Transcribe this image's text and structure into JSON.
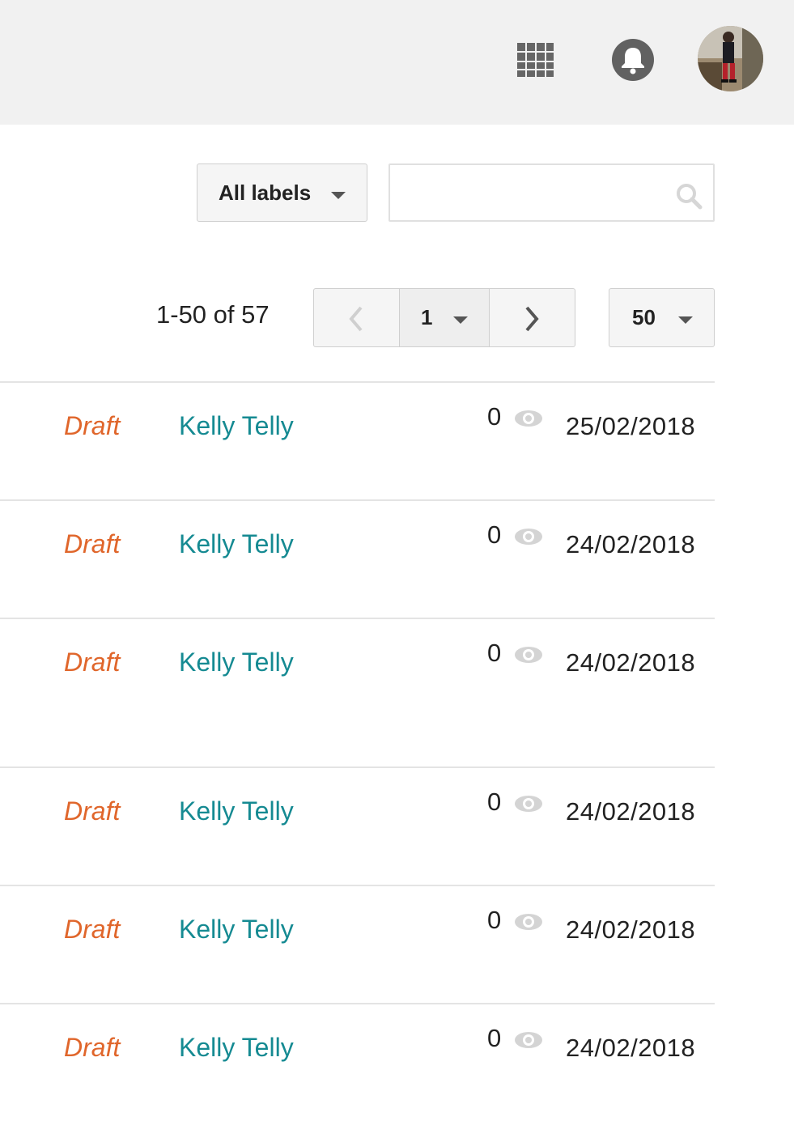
{
  "topbar": {
    "apps_icon": "apps-grid-icon",
    "notifications_icon": "bell-icon",
    "avatar_icon": "user-avatar"
  },
  "filters": {
    "labels_select": "All labels",
    "search_placeholder": "",
    "search_icon": "search-icon"
  },
  "pagination": {
    "range": "1-50 of 57",
    "current_page": "1",
    "per_page": "50",
    "prev_icon": "chevron-left-icon",
    "next_icon": "chevron-right-icon"
  },
  "posts": [
    {
      "status": "Draft",
      "author": "Kelly Telly",
      "views": "0",
      "date": "25/02/2018"
    },
    {
      "status": "Draft",
      "author": "Kelly Telly",
      "views": "0",
      "date": "24/02/2018"
    },
    {
      "status": "Draft",
      "author": "Kelly Telly",
      "views": "0",
      "date": "24/02/2018"
    },
    {
      "status": "Draft",
      "author": "Kelly Telly",
      "views": "0",
      "date": "24/02/2018"
    },
    {
      "status": "Draft",
      "author": "Kelly Telly",
      "views": "0",
      "date": "24/02/2018"
    },
    {
      "status": "Draft",
      "author": "Kelly Telly",
      "views": "0",
      "date": "24/02/2018"
    }
  ],
  "colors": {
    "status_draft": "#e0662b",
    "author_link": "#158a92",
    "topbar_bg": "#f1f1f1"
  }
}
